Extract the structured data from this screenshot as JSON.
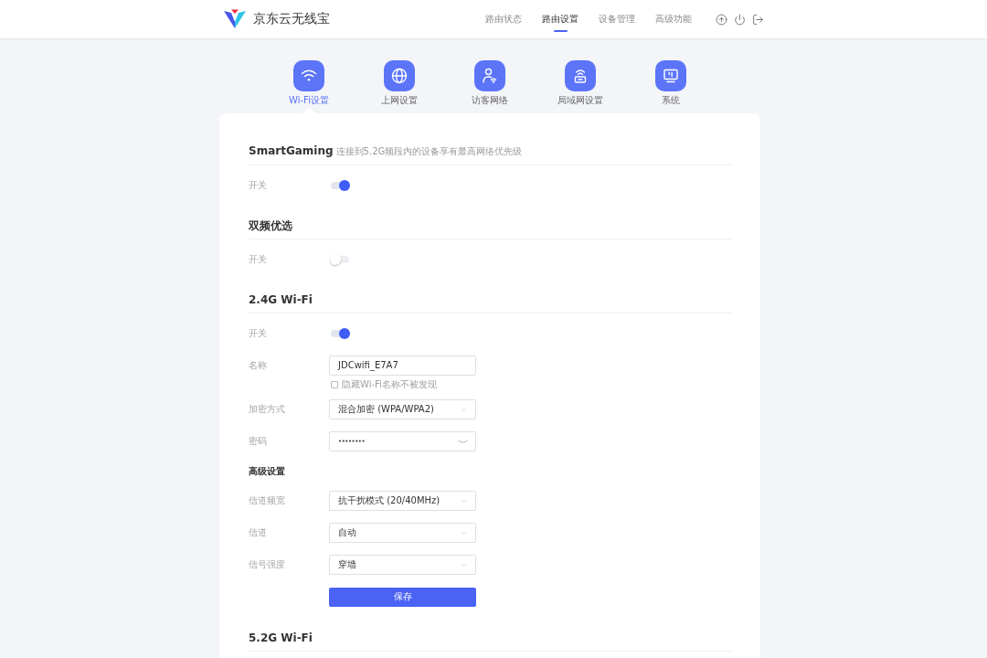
{
  "header": {
    "logo": "京东云无线宝",
    "nav": [
      {
        "label": "路由状态",
        "selected": false
      },
      {
        "label": "路由设置",
        "selected": true
      },
      {
        "label": "设备管理",
        "selected": false
      },
      {
        "label": "高级功能",
        "selected": false
      }
    ]
  },
  "tiles": [
    {
      "label": "Wi-Fi设置",
      "selected": true
    },
    {
      "label": "上网设置",
      "selected": false
    },
    {
      "label": "访客网络",
      "selected": false
    },
    {
      "label": "局域网设置",
      "selected": false
    },
    {
      "label": "系统",
      "selected": false
    }
  ],
  "sections": [
    {
      "title": "SmartGaming",
      "subtitle": "连接到5.2G频段内的设备享有最高网络优先级",
      "rows": [
        {
          "kind": "switch",
          "label": "开关",
          "on": true
        }
      ]
    },
    {
      "title": "双频优选",
      "rows": [
        {
          "kind": "switch",
          "label": "开关",
          "on": false
        }
      ]
    },
    {
      "title": "2.4G Wi-Fi",
      "rows": [
        {
          "kind": "switch",
          "label": "开关",
          "on": true
        },
        {
          "kind": "text",
          "label": "名称",
          "value": "JDCwifi_E7A7",
          "checkbox": {
            "label": "隐藏Wi-Fi名称不被发现",
            "checked": false
          }
        },
        {
          "kind": "select",
          "label": "加密方式",
          "value": "混合加密 (WPA/WPA2)"
        },
        {
          "kind": "password",
          "label": "密码",
          "value": "••••••••"
        },
        {
          "kind": "heading",
          "label": "高级设置"
        },
        {
          "kind": "select",
          "label": "信道频宽",
          "value": "抗干扰模式 (20/40MHz)"
        },
        {
          "kind": "select",
          "label": "信道",
          "value": "自动"
        },
        {
          "kind": "select",
          "label": "信号强度",
          "value": "穿墙"
        },
        {
          "kind": "button",
          "label": "保存"
        }
      ]
    },
    {
      "title": "5.2G Wi-Fi"
    }
  ]
}
